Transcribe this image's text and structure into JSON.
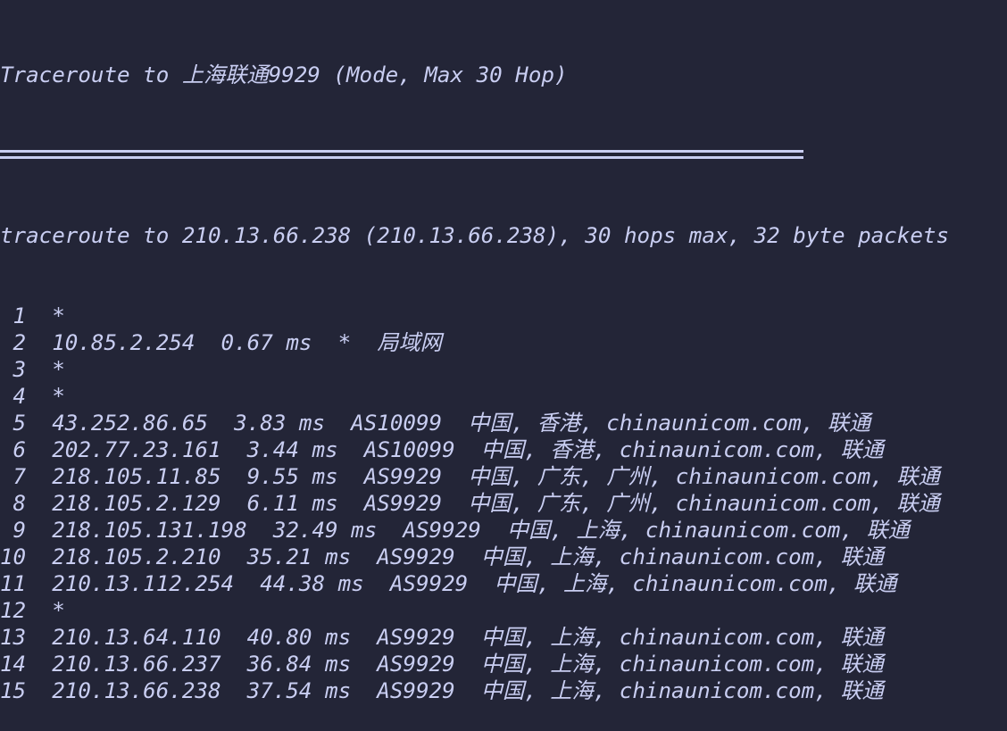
{
  "title": "Traceroute to 上海联通9929 (Mode, Max 30 Hop)",
  "header": "traceroute to 210.13.66.238 (210.13.66.238), 30 hops max, 32 byte packets",
  "hops": [
    {
      "hop": "1",
      "ip": "*"
    },
    {
      "hop": "2",
      "ip": "10.85.2.254",
      "rtt": "0.67 ms",
      "asn": "*",
      "loc": "局域网"
    },
    {
      "hop": "3",
      "ip": "*"
    },
    {
      "hop": "4",
      "ip": "*"
    },
    {
      "hop": "5",
      "ip": "43.252.86.65",
      "rtt": "3.83 ms",
      "asn": "AS10099",
      "loc": "中国, 香港, chinaunicom.com, 联通"
    },
    {
      "hop": "6",
      "ip": "202.77.23.161",
      "rtt": "3.44 ms",
      "asn": "AS10099",
      "loc": "中国, 香港, chinaunicom.com, 联通"
    },
    {
      "hop": "7",
      "ip": "218.105.11.85",
      "rtt": "9.55 ms",
      "asn": "AS9929",
      "loc": "中国, 广东, 广州, chinaunicom.com, 联通"
    },
    {
      "hop": "8",
      "ip": "218.105.2.129",
      "rtt": "6.11 ms",
      "asn": "AS9929",
      "loc": "中国, 广东, 广州, chinaunicom.com, 联通"
    },
    {
      "hop": "9",
      "ip": "218.105.131.198",
      "rtt": "32.49 ms",
      "asn": "AS9929",
      "loc": "中国, 上海, chinaunicom.com, 联通"
    },
    {
      "hop": "10",
      "ip": "218.105.2.210",
      "rtt": "35.21 ms",
      "asn": "AS9929",
      "loc": "中国, 上海, chinaunicom.com, 联通"
    },
    {
      "hop": "11",
      "ip": "210.13.112.254",
      "rtt": "44.38 ms",
      "asn": "AS9929",
      "loc": "中国, 上海, chinaunicom.com, 联通"
    },
    {
      "hop": "12",
      "ip": "*"
    },
    {
      "hop": "13",
      "ip": "210.13.64.110",
      "rtt": "40.80 ms",
      "asn": "AS9929",
      "loc": "中国, 上海, chinaunicom.com, 联通"
    },
    {
      "hop": "14",
      "ip": "210.13.66.237",
      "rtt": "36.84 ms",
      "asn": "AS9929",
      "loc": "中国, 上海, chinaunicom.com, 联通"
    },
    {
      "hop": "15",
      "ip": "210.13.66.238",
      "rtt": "37.54 ms",
      "asn": "AS9929",
      "loc": "中国, 上海, chinaunicom.com, 联通"
    }
  ]
}
